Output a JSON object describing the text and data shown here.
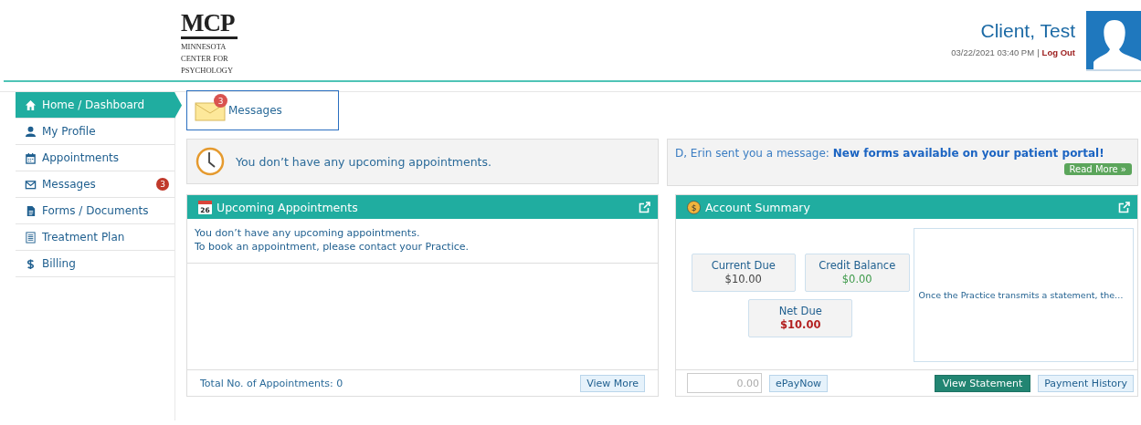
{
  "logo": {
    "title": "MCP",
    "subtitle": [
      "MINNESOTA",
      "CENTER FOR",
      "PSYCHOLOGY"
    ]
  },
  "user": {
    "name": "Client, Test",
    "datetime": "03/22/2021 03:40 PM",
    "separator": "|",
    "logout": "Log Out"
  },
  "sidebar": {
    "items": [
      {
        "label": "Home / Dashboard",
        "selected": true
      },
      {
        "label": "My Profile",
        "selected": false
      },
      {
        "label": "Appointments",
        "selected": false
      },
      {
        "label": "Messages",
        "selected": false,
        "badge": "3"
      },
      {
        "label": "Forms / Documents",
        "selected": false
      },
      {
        "label": "Treatment Plan",
        "selected": false
      },
      {
        "label": "Billing",
        "selected": false
      }
    ]
  },
  "messages_tile": {
    "label": "Messages",
    "badge": "3"
  },
  "appointment_notice": "You don’t have any upcoming appointments.",
  "message_notice": {
    "text": "D, Erin sent you a message: **New forms available on your patient portal!**",
    "button": "Read More »"
  },
  "upcoming": {
    "title": "Upcoming Appointments",
    "calendar_day": "26",
    "lines": [
      "You don’t have any upcoming appointments.",
      "To book an appointment, please contact your Practice."
    ],
    "total": "Total No. of Appointments: 0",
    "button": "View More"
  },
  "account": {
    "title": "Account Summary",
    "coin": "$",
    "tiles": [
      {
        "label": "Current Due",
        "value": "$10.00",
        "kind": "plain"
      },
      {
        "label": "Credit Balance",
        "value": "$0.00",
        "kind": "credit"
      },
      {
        "label": "Net Due",
        "value": "$10.00",
        "kind": "due"
      }
    ],
    "statement_note": "Once the Practice transmits a statement, the…",
    "amount": {
      "placeholder": "0.00"
    },
    "buttons": [
      {
        "label": "ePayNow",
        "kind": "light"
      },
      {
        "label": "View Statement",
        "kind": "primary"
      },
      {
        "label": "Payment History",
        "kind": "light"
      }
    ]
  }
}
